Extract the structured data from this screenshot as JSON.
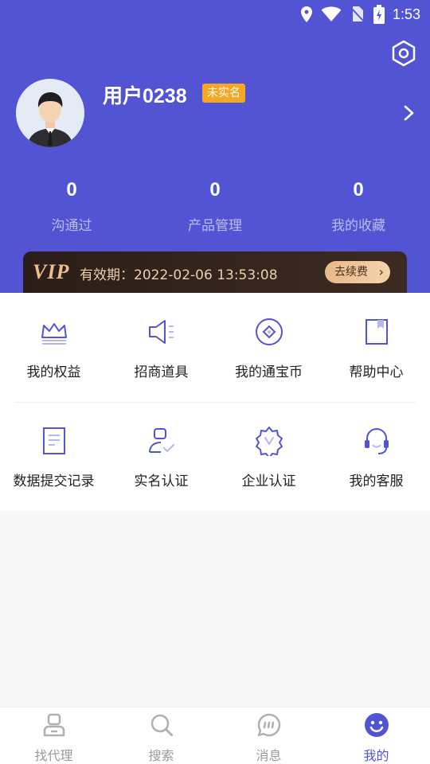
{
  "status_bar": {
    "time": "1:53"
  },
  "profile": {
    "username": "用户0238",
    "badge": "未实名"
  },
  "stats": [
    {
      "value": "0",
      "label": "沟通过"
    },
    {
      "value": "0",
      "label": "产品管理"
    },
    {
      "value": "0",
      "label": "我的收藏"
    }
  ],
  "vip": {
    "logo": "VIP",
    "expiry": "有效期：2022-02-06 13:53:08",
    "renew_label": "去续费"
  },
  "grid": {
    "row1": [
      {
        "label": "我的权益",
        "icon": "crown-icon"
      },
      {
        "label": "招商道具",
        "icon": "megaphone-icon"
      },
      {
        "label": "我的通宝币",
        "icon": "coin-icon"
      },
      {
        "label": "帮助中心",
        "icon": "book-icon"
      }
    ],
    "row2": [
      {
        "label": "数据提交记录",
        "icon": "document-icon"
      },
      {
        "label": "实名认证",
        "icon": "user-verify-icon"
      },
      {
        "label": "企业认证",
        "icon": "badge-verify-icon"
      },
      {
        "label": "我的客服",
        "icon": "headset-icon"
      }
    ]
  },
  "tabbar": [
    {
      "label": "找代理",
      "icon": "agent-icon",
      "active": false
    },
    {
      "label": "搜索",
      "icon": "search-icon",
      "active": false
    },
    {
      "label": "消息",
      "icon": "message-icon",
      "active": false
    },
    {
      "label": "我的",
      "icon": "smile-icon",
      "active": true
    }
  ],
  "colors": {
    "primary": "#5254d4",
    "badge": "#f5a623",
    "vip_gold": "#e9c08a",
    "vip_bg": "#2b1e18"
  }
}
